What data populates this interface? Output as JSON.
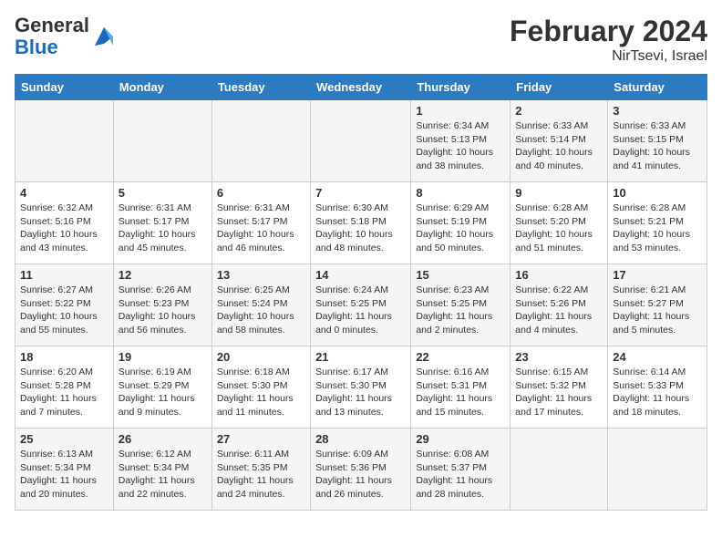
{
  "header": {
    "logo_line1": "General",
    "logo_line2": "Blue",
    "month_year": "February 2024",
    "location": "NirTsevi, Israel"
  },
  "weekdays": [
    "Sunday",
    "Monday",
    "Tuesday",
    "Wednesday",
    "Thursday",
    "Friday",
    "Saturday"
  ],
  "weeks": [
    [
      {
        "day": "",
        "info": ""
      },
      {
        "day": "",
        "info": ""
      },
      {
        "day": "",
        "info": ""
      },
      {
        "day": "",
        "info": ""
      },
      {
        "day": "1",
        "info": "Sunrise: 6:34 AM\nSunset: 5:13 PM\nDaylight: 10 hours\nand 38 minutes."
      },
      {
        "day": "2",
        "info": "Sunrise: 6:33 AM\nSunset: 5:14 PM\nDaylight: 10 hours\nand 40 minutes."
      },
      {
        "day": "3",
        "info": "Sunrise: 6:33 AM\nSunset: 5:15 PM\nDaylight: 10 hours\nand 41 minutes."
      }
    ],
    [
      {
        "day": "4",
        "info": "Sunrise: 6:32 AM\nSunset: 5:16 PM\nDaylight: 10 hours\nand 43 minutes."
      },
      {
        "day": "5",
        "info": "Sunrise: 6:31 AM\nSunset: 5:17 PM\nDaylight: 10 hours\nand 45 minutes."
      },
      {
        "day": "6",
        "info": "Sunrise: 6:31 AM\nSunset: 5:17 PM\nDaylight: 10 hours\nand 46 minutes."
      },
      {
        "day": "7",
        "info": "Sunrise: 6:30 AM\nSunset: 5:18 PM\nDaylight: 10 hours\nand 48 minutes."
      },
      {
        "day": "8",
        "info": "Sunrise: 6:29 AM\nSunset: 5:19 PM\nDaylight: 10 hours\nand 50 minutes."
      },
      {
        "day": "9",
        "info": "Sunrise: 6:28 AM\nSunset: 5:20 PM\nDaylight: 10 hours\nand 51 minutes."
      },
      {
        "day": "10",
        "info": "Sunrise: 6:28 AM\nSunset: 5:21 PM\nDaylight: 10 hours\nand 53 minutes."
      }
    ],
    [
      {
        "day": "11",
        "info": "Sunrise: 6:27 AM\nSunset: 5:22 PM\nDaylight: 10 hours\nand 55 minutes."
      },
      {
        "day": "12",
        "info": "Sunrise: 6:26 AM\nSunset: 5:23 PM\nDaylight: 10 hours\nand 56 minutes."
      },
      {
        "day": "13",
        "info": "Sunrise: 6:25 AM\nSunset: 5:24 PM\nDaylight: 10 hours\nand 58 minutes."
      },
      {
        "day": "14",
        "info": "Sunrise: 6:24 AM\nSunset: 5:25 PM\nDaylight: 11 hours\nand 0 minutes."
      },
      {
        "day": "15",
        "info": "Sunrise: 6:23 AM\nSunset: 5:25 PM\nDaylight: 11 hours\nand 2 minutes."
      },
      {
        "day": "16",
        "info": "Sunrise: 6:22 AM\nSunset: 5:26 PM\nDaylight: 11 hours\nand 4 minutes."
      },
      {
        "day": "17",
        "info": "Sunrise: 6:21 AM\nSunset: 5:27 PM\nDaylight: 11 hours\nand 5 minutes."
      }
    ],
    [
      {
        "day": "18",
        "info": "Sunrise: 6:20 AM\nSunset: 5:28 PM\nDaylight: 11 hours\nand 7 minutes."
      },
      {
        "day": "19",
        "info": "Sunrise: 6:19 AM\nSunset: 5:29 PM\nDaylight: 11 hours\nand 9 minutes."
      },
      {
        "day": "20",
        "info": "Sunrise: 6:18 AM\nSunset: 5:30 PM\nDaylight: 11 hours\nand 11 minutes."
      },
      {
        "day": "21",
        "info": "Sunrise: 6:17 AM\nSunset: 5:30 PM\nDaylight: 11 hours\nand 13 minutes."
      },
      {
        "day": "22",
        "info": "Sunrise: 6:16 AM\nSunset: 5:31 PM\nDaylight: 11 hours\nand 15 minutes."
      },
      {
        "day": "23",
        "info": "Sunrise: 6:15 AM\nSunset: 5:32 PM\nDaylight: 11 hours\nand 17 minutes."
      },
      {
        "day": "24",
        "info": "Sunrise: 6:14 AM\nSunset: 5:33 PM\nDaylight: 11 hours\nand 18 minutes."
      }
    ],
    [
      {
        "day": "25",
        "info": "Sunrise: 6:13 AM\nSunset: 5:34 PM\nDaylight: 11 hours\nand 20 minutes."
      },
      {
        "day": "26",
        "info": "Sunrise: 6:12 AM\nSunset: 5:34 PM\nDaylight: 11 hours\nand 22 minutes."
      },
      {
        "day": "27",
        "info": "Sunrise: 6:11 AM\nSunset: 5:35 PM\nDaylight: 11 hours\nand 24 minutes."
      },
      {
        "day": "28",
        "info": "Sunrise: 6:09 AM\nSunset: 5:36 PM\nDaylight: 11 hours\nand 26 minutes."
      },
      {
        "day": "29",
        "info": "Sunrise: 6:08 AM\nSunset: 5:37 PM\nDaylight: 11 hours\nand 28 minutes."
      },
      {
        "day": "",
        "info": ""
      },
      {
        "day": "",
        "info": ""
      }
    ]
  ]
}
